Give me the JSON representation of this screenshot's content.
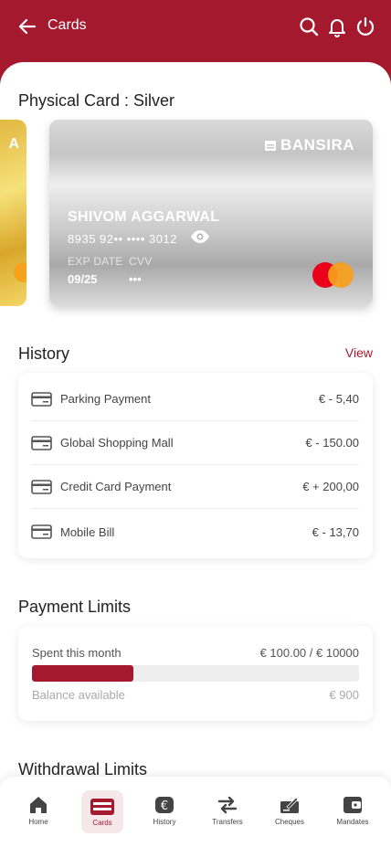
{
  "header": {
    "title": "Cards"
  },
  "physical_card": {
    "section_title": "Physical Card : Silver",
    "gold_card_partial_text": "A",
    "brand": "BANSIRA",
    "holder_name": "SHIVOM AGGARWAL",
    "number_masked": "8935 92•• •••• 3012",
    "exp_label": "EXP DATE",
    "exp_value": "09/25",
    "cvv_label": "CVV",
    "cvv_value": "•••"
  },
  "history": {
    "section_title": "History",
    "view_label": "View",
    "items": [
      {
        "name": "Parking Payment",
        "amount": "€ - 5,40"
      },
      {
        "name": "Global Shopping Mall",
        "amount": "€ - 150.00"
      },
      {
        "name": "Credit Card Payment",
        "amount": "€ + 200,00"
      },
      {
        "name": "Mobile Bill",
        "amount": "€ - 13,70"
      }
    ]
  },
  "payment_limits": {
    "section_title": "Payment Limits",
    "spent_label": "Spent this month",
    "spent_value": "€ 100.00 / € 10000",
    "progress_fraction": 0.31,
    "balance_label": "Balance available",
    "balance_value": "€ 900"
  },
  "withdrawal_limits": {
    "section_title": "Withdrawal Limits"
  },
  "bottom_nav": {
    "items": [
      {
        "label": "Home",
        "icon": "home-icon"
      },
      {
        "label": "Cards",
        "icon": "card-icon",
        "active": true
      },
      {
        "label": "History",
        "icon": "euro-icon"
      },
      {
        "label": "Transfers",
        "icon": "transfer-icon"
      },
      {
        "label": "Cheques",
        "icon": "cheque-icon"
      },
      {
        "label": "Mandates",
        "icon": "wallet-icon"
      }
    ]
  },
  "colors": {
    "brand": "#a5192e",
    "active_nav_bg": "#f6e8ea"
  }
}
